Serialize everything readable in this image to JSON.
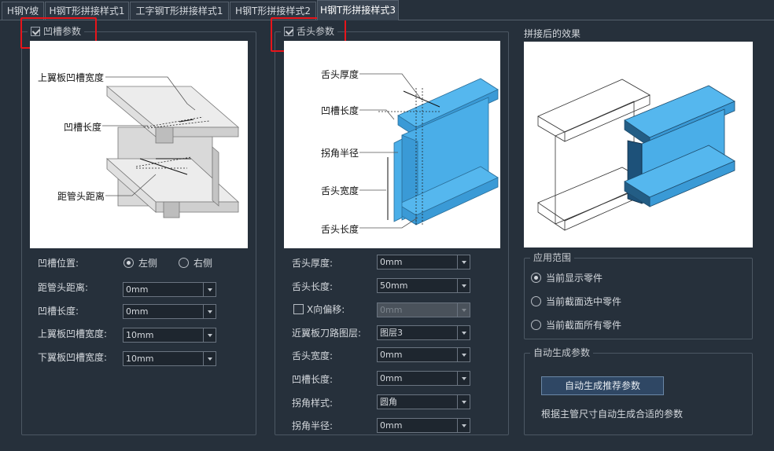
{
  "tabs": [
    "H钢Y坡",
    "H钢T形拼接样式1",
    "工字钢T形拼接样式1",
    "H钢T形拼接样式2",
    "H钢T形拼接样式3"
  ],
  "groove": {
    "title": "凹槽参数",
    "checked": true,
    "diagram_labels": {
      "upper_flange_width": "上翼板凹槽宽度",
      "groove_length": "凹槽长度",
      "pipe_end_distance": "距管头距离"
    },
    "fields": {
      "position_label": "凹槽位置:",
      "position_left": "左侧",
      "position_right": "右侧",
      "position_selected": "左侧",
      "distance_label": "距管头距离:",
      "distance_value": "0mm",
      "length_label": "凹槽长度:",
      "length_value": "0mm",
      "upper_width_label": "上翼板凹槽宽度:",
      "upper_width_value": "10mm",
      "lower_width_label": "下翼板凹槽宽度:",
      "lower_width_value": "10mm"
    }
  },
  "tongue": {
    "title": "舌头参数",
    "checked": true,
    "diagram_labels": {
      "thickness": "舌头厚度",
      "groove_length": "凹槽长度",
      "corner_radius": "拐角半径",
      "width": "舌头宽度",
      "length": "舌头长度"
    },
    "fields": {
      "thickness_label": "舌头厚度:",
      "thickness_value": "0mm",
      "length_label": "舌头长度:",
      "length_value": "50mm",
      "x_offset_label": "X向偏移:",
      "x_offset_value": "0mm",
      "x_offset_checked": false,
      "layer_label": "近翼板刀路图层:",
      "layer_value": "图层3",
      "width_label": "舌头宽度:",
      "width_value": "0mm",
      "groove_length_label": "凹槽长度:",
      "groove_length_value": "0mm",
      "corner_style_label": "拐角样式:",
      "corner_style_value": "圆角",
      "corner_radius_label": "拐角半径:",
      "corner_radius_value": "0mm"
    }
  },
  "result": {
    "title": "拼接后的效果"
  },
  "scope": {
    "title": "应用范围",
    "options": [
      "当前显示零件",
      "当前截面选中零件",
      "当前截面所有零件"
    ],
    "selected": "当前显示零件"
  },
  "auto": {
    "title": "自动生成参数",
    "button": "自动生成推荐参数",
    "hint": "根据主管尺寸自动生成合适的参数"
  },
  "colors": {
    "accent_blue": "#4aaee8",
    "highlight_red": "#e8141a",
    "background": "#26303b"
  }
}
